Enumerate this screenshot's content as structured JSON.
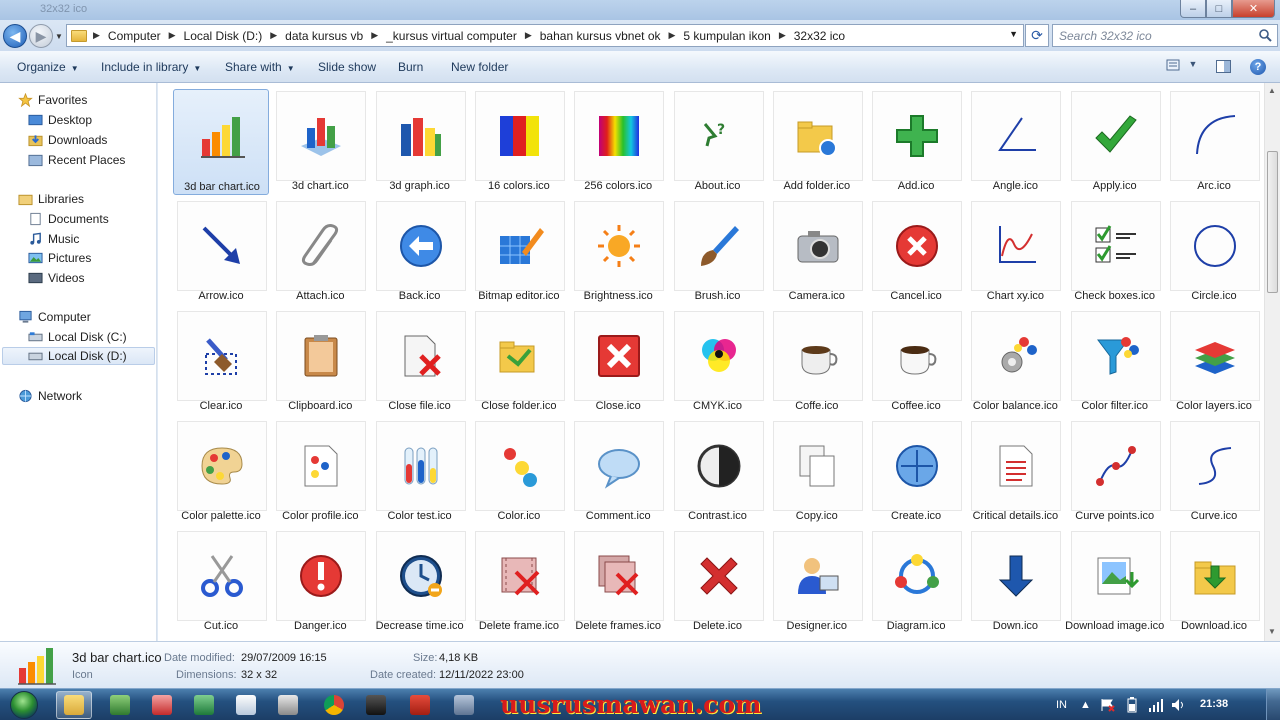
{
  "window": {
    "title": "32x32 ico",
    "controls": {
      "minimize": "–",
      "maximize": "□",
      "close": "✕"
    }
  },
  "address": {
    "breadcrumbs": [
      "Computer",
      "Local Disk (D:)",
      "data kursus vb",
      "_kursus virtual computer",
      "bahan kursus vbnet ok",
      "5 kumpulan ikon",
      "32x32 ico"
    ],
    "search_placeholder": "Search 32x32 ico"
  },
  "commands": {
    "organize": "Organize",
    "include": "Include in library",
    "share": "Share with",
    "slideshow": "Slide show",
    "burn": "Burn",
    "newfolder": "New folder"
  },
  "nav": {
    "favorites": "Favorites",
    "desktop": "Desktop",
    "downloads": "Downloads",
    "recent": "Recent Places",
    "libraries": "Libraries",
    "documents": "Documents",
    "music": "Music",
    "pictures": "Pictures",
    "videos": "Videos",
    "computer": "Computer",
    "diskc": "Local Disk (C:)",
    "diskd": "Local Disk (D:)",
    "network": "Network"
  },
  "files": [
    {
      "name": "3d bar chart.ico",
      "icon": "bar-chart-icon"
    },
    {
      "name": "3d chart.ico",
      "icon": "3d-chart-icon"
    },
    {
      "name": "3d graph.ico",
      "icon": "3d-graph-icon"
    },
    {
      "name": "16 colors.ico",
      "icon": "16-colors-icon"
    },
    {
      "name": "256 colors.ico",
      "icon": "256-colors-icon"
    },
    {
      "name": "About.ico",
      "icon": "about-icon"
    },
    {
      "name": "Add folder.ico",
      "icon": "add-folder-icon"
    },
    {
      "name": "Add.ico",
      "icon": "add-icon"
    },
    {
      "name": "Angle.ico",
      "icon": "angle-icon"
    },
    {
      "name": "Apply.ico",
      "icon": "apply-icon"
    },
    {
      "name": "Arc.ico",
      "icon": "arc-icon"
    },
    {
      "name": "Arrow.ico",
      "icon": "arrow-icon"
    },
    {
      "name": "Attach.ico",
      "icon": "attach-icon"
    },
    {
      "name": "Back.ico",
      "icon": "back-icon"
    },
    {
      "name": "Bitmap editor.ico",
      "icon": "bitmap-editor-icon"
    },
    {
      "name": "Brightness.ico",
      "icon": "brightness-icon"
    },
    {
      "name": "Brush.ico",
      "icon": "brush-icon"
    },
    {
      "name": "Camera.ico",
      "icon": "camera-icon"
    },
    {
      "name": "Cancel.ico",
      "icon": "cancel-icon"
    },
    {
      "name": "Chart xy.ico",
      "icon": "chart-xy-icon"
    },
    {
      "name": "Check boxes.ico",
      "icon": "check-boxes-icon"
    },
    {
      "name": "Circle.ico",
      "icon": "circle-icon"
    },
    {
      "name": "Clear.ico",
      "icon": "clear-icon"
    },
    {
      "name": "Clipboard.ico",
      "icon": "clipboard-icon"
    },
    {
      "name": "Close file.ico",
      "icon": "close-file-icon"
    },
    {
      "name": "Close folder.ico",
      "icon": "close-folder-icon"
    },
    {
      "name": "Close.ico",
      "icon": "close-icon"
    },
    {
      "name": "CMYK.ico",
      "icon": "cmyk-icon"
    },
    {
      "name": "Coffe.ico",
      "icon": "coffe-icon"
    },
    {
      "name": "Coffee.ico",
      "icon": "coffee-icon"
    },
    {
      "name": "Color balance.ico",
      "icon": "color-balance-icon"
    },
    {
      "name": "Color filter.ico",
      "icon": "color-filter-icon"
    },
    {
      "name": "Color layers.ico",
      "icon": "color-layers-icon"
    },
    {
      "name": "Color palette.ico",
      "icon": "color-palette-icon"
    },
    {
      "name": "Color profile.ico",
      "icon": "color-profile-icon"
    },
    {
      "name": "Color test.ico",
      "icon": "color-test-icon"
    },
    {
      "name": "Color.ico",
      "icon": "color-icon"
    },
    {
      "name": "Comment.ico",
      "icon": "comment-icon"
    },
    {
      "name": "Contrast.ico",
      "icon": "contrast-icon"
    },
    {
      "name": "Copy.ico",
      "icon": "copy-icon"
    },
    {
      "name": "Create.ico",
      "icon": "create-icon"
    },
    {
      "name": "Critical details.ico",
      "icon": "critical-details-icon"
    },
    {
      "name": "Curve points.ico",
      "icon": "curve-points-icon"
    },
    {
      "name": "Curve.ico",
      "icon": "curve-icon"
    },
    {
      "name": "Cut.ico",
      "icon": "cut-icon"
    },
    {
      "name": "Danger.ico",
      "icon": "danger-icon"
    },
    {
      "name": "Decrease time.ico",
      "icon": "decrease-time-icon"
    },
    {
      "name": "Delete frame.ico",
      "icon": "delete-frame-icon"
    },
    {
      "name": "Delete frames.ico",
      "icon": "delete-frames-icon"
    },
    {
      "name": "Delete.ico",
      "icon": "delete-icon"
    },
    {
      "name": "Designer.ico",
      "icon": "designer-icon"
    },
    {
      "name": "Diagram.ico",
      "icon": "diagram-icon"
    },
    {
      "name": "Down.ico",
      "icon": "down-icon"
    },
    {
      "name": "Download image.ico",
      "icon": "download-image-icon"
    },
    {
      "name": "Download.ico",
      "icon": "download-icon"
    }
  ],
  "selected_index": 0,
  "details": {
    "name": "3d bar chart.ico",
    "type": "Icon",
    "modified_label": "Date modified:",
    "modified": "29/07/2009 16:15",
    "dimensions_label": "Dimensions:",
    "dimensions": "32 x 32",
    "size_label": "Size:",
    "size": "4,18 KB",
    "created_label": "Date created:",
    "created": "12/11/2022 23:00"
  },
  "taskbar": {
    "watermark": "uusrusmawan.com",
    "lang": "IN",
    "clock": "21:38"
  },
  "colors": {
    "accent": "#1e57ad",
    "selection": "#cde0f6",
    "watermark": "#d81b1b"
  }
}
